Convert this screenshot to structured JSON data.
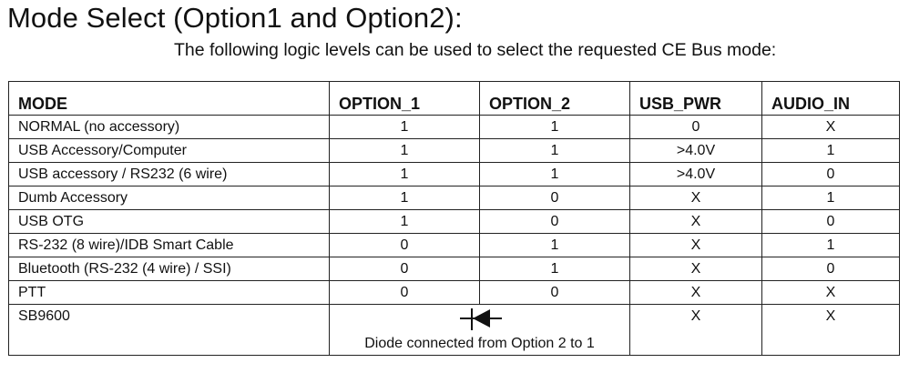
{
  "title": "Mode Select (Option1 and Option2):",
  "subtitle": "The following logic levels can be used to select the requested CE Bus mode:",
  "table": {
    "headers": [
      "MODE",
      "OPTION_1",
      "OPTION_2",
      "USB_PWR",
      "AUDIO_IN"
    ],
    "rows": [
      [
        "NORMAL (no accessory)",
        "1",
        "1",
        "0",
        "X"
      ],
      [
        "USB Accessory/Computer",
        "1",
        "1",
        ">4.0V",
        "1"
      ],
      [
        "USB accessory / RS232 (6 wire)",
        "1",
        "1",
        ">4.0V",
        "0"
      ],
      [
        "Dumb Accessory",
        "1",
        "0",
        "X",
        "1"
      ],
      [
        "USB OTG",
        "1",
        "0",
        "X",
        "0"
      ],
      [
        "RS-232 (8 wire)/IDB Smart Cable",
        "0",
        "1",
        "X",
        "1"
      ],
      [
        "Bluetooth (RS-232 (4 wire) / SSI)",
        "0",
        "1",
        "X",
        "0"
      ],
      [
        "PTT",
        "0",
        "0",
        "X",
        "X"
      ]
    ],
    "last_row": {
      "mode": "SB9600",
      "options_note": "Diode connected from Option 2 to 1",
      "options_icon": "diode-icon",
      "usb_pwr": "X",
      "audio_in": "X"
    }
  }
}
